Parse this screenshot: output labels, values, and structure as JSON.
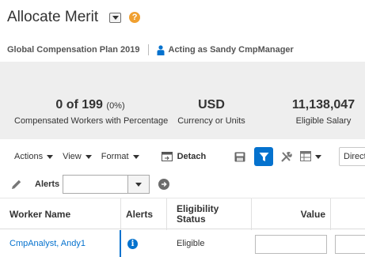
{
  "page": {
    "title": "Allocate Merit",
    "help_glyph": "?"
  },
  "context": {
    "plan": "Global Compensation Plan 2019",
    "acting_as": "Acting as Sandy CmpManager"
  },
  "summary": {
    "compensated": {
      "value": "0 of 199",
      "percent": "(0%)",
      "label": "Compensated Workers with Percentage"
    },
    "currency": {
      "value": "USD",
      "label": "Currency or Units"
    },
    "eligible": {
      "value": "11,138,047",
      "label": "Eligible Salary"
    }
  },
  "toolbar": {
    "actions_label": "Actions",
    "view_label": "View",
    "format_label": "Format",
    "detach_label": "Detach",
    "direct_select_value": "Direct"
  },
  "alerts_filter": {
    "label": "Alerts",
    "value": ""
  },
  "table": {
    "headers": {
      "worker_name": "Worker Name",
      "alerts": "Alerts",
      "eligibility_line1": "Eligibility",
      "eligibility_line2": "Status",
      "value": "Value"
    },
    "rows": [
      {
        "worker_name": "CmpAnalyst, Andy1",
        "eligibility": "Eligible",
        "value": ""
      }
    ]
  },
  "colors": {
    "accent": "#0572ce",
    "help": "#f0a030",
    "summary_bg": "#eeeeee"
  },
  "icons": {
    "title_menu": "chevron-down-icon",
    "help": "help-icon",
    "acting_as": "person-icon",
    "detach": "detach-icon",
    "save": "save-icon",
    "filter": "filter-icon",
    "tools": "tools-icon",
    "freeze": "freeze-columns-icon",
    "edit": "pencil-icon",
    "go": "arrow-right-icon",
    "info": "info-icon"
  }
}
